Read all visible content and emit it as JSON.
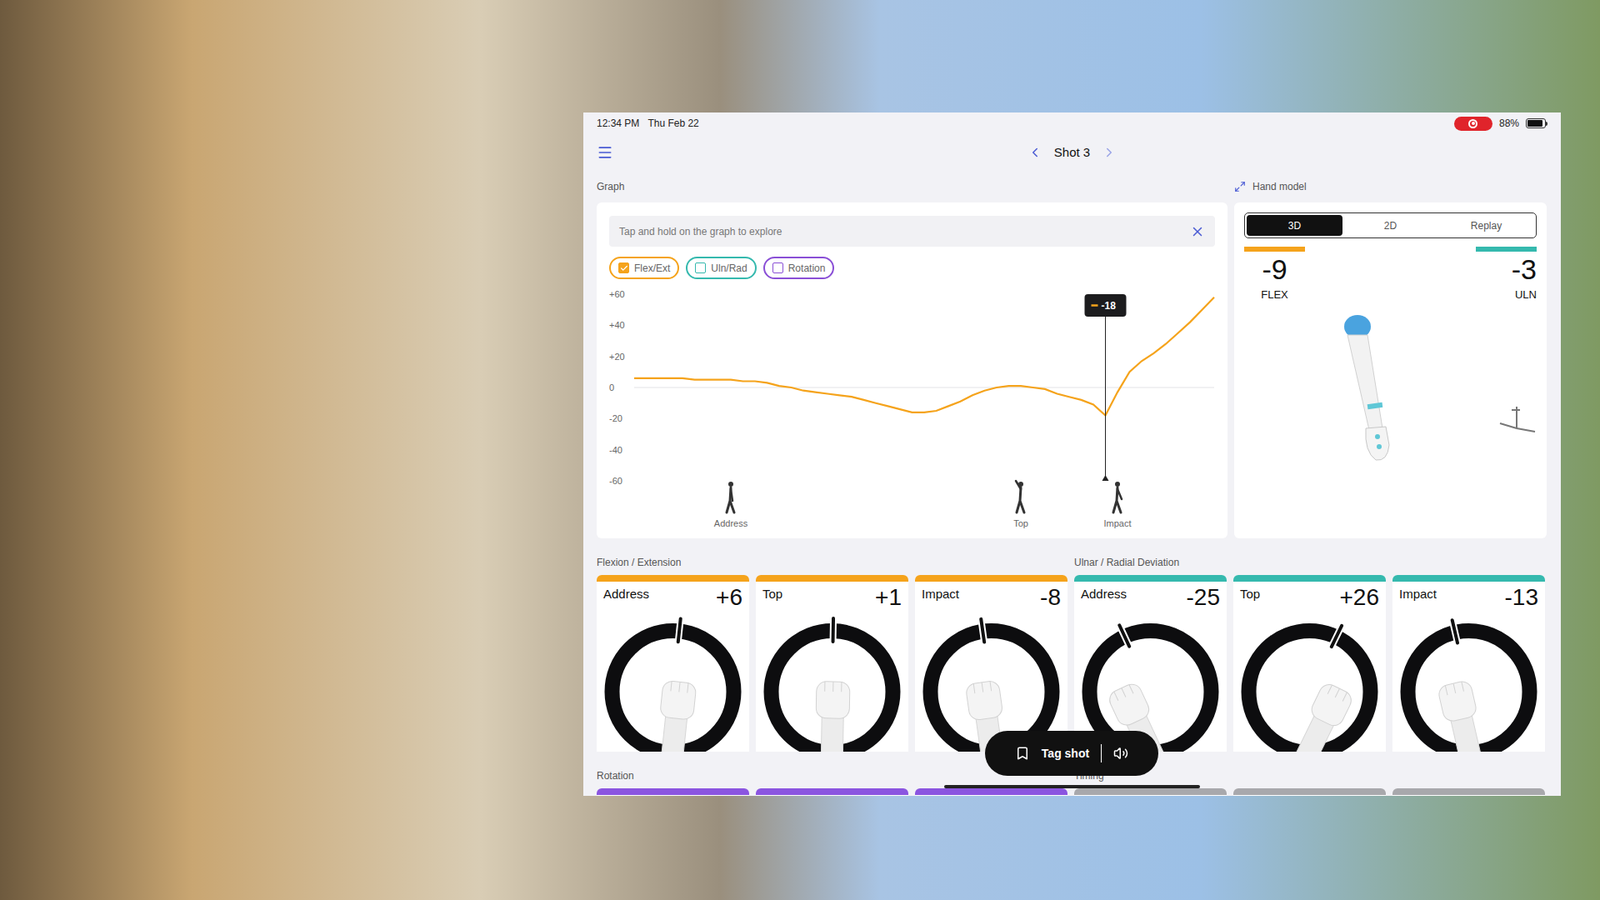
{
  "status_bar": {
    "time": "12:34 PM",
    "date": "Thu Feb 22",
    "battery": "88%",
    "battery_level": 0.88,
    "recording": true
  },
  "nav": {
    "title": "Shot 3"
  },
  "graph": {
    "title": "Graph",
    "hint": "Tap and hold on the graph to explore",
    "filters": [
      {
        "label": "Flex/Ext",
        "checked": true,
        "color": "#f5a31b"
      },
      {
        "label": "Uln/Rad",
        "checked": false,
        "color": "#35b9ae"
      },
      {
        "label": "Rotation",
        "checked": false,
        "color": "#8a4fd6"
      }
    ],
    "y_ticks": [
      {
        "label": "+60",
        "value": 60
      },
      {
        "label": "+40",
        "value": 40
      },
      {
        "label": "+20",
        "value": 20
      },
      {
        "label": "0",
        "value": 0
      },
      {
        "label": "-20",
        "value": -20
      },
      {
        "label": "-40",
        "value": -40
      },
      {
        "label": "-60",
        "value": -60
      }
    ],
    "series": [
      {
        "name": "Flex/Ext",
        "color": "#f5a31b",
        "values": [
          6,
          6,
          6,
          6,
          6,
          5,
          5,
          5,
          5,
          4,
          4,
          3,
          1,
          0,
          -2,
          -3,
          -4,
          -5,
          -6,
          -8,
          -10,
          -12,
          -14,
          -16,
          -16,
          -15,
          -12,
          -9,
          -5,
          -2,
          0,
          1,
          1,
          0,
          -1,
          -4,
          -6,
          -8,
          -11,
          -18,
          -3,
          10,
          17,
          22,
          28,
          35,
          42,
          50,
          58
        ]
      }
    ],
    "cursor": {
      "index": 39,
      "label": "-18"
    },
    "events": [
      {
        "label": "Address",
        "index": 8
      },
      {
        "label": "Top",
        "index": 32
      },
      {
        "label": "Impact",
        "index": 40
      }
    ]
  },
  "hand_model": {
    "title": "Hand model",
    "tabs": [
      {
        "label": "3D",
        "selected": true
      },
      {
        "label": "2D",
        "selected": false
      },
      {
        "label": "Replay",
        "selected": false
      }
    ],
    "readouts": [
      {
        "value": "-9",
        "label": "FLEX",
        "color": "#f5a31b"
      },
      {
        "value": "-3",
        "label": "ULN",
        "color": "#35b9ae"
      }
    ]
  },
  "metric_groups": [
    {
      "title": "Flexion / Extension",
      "color": "#f5a31b",
      "cards": [
        {
          "label": "Address",
          "value": "+6"
        },
        {
          "label": "Top",
          "value": "+1"
        },
        {
          "label": "Impact",
          "value": "-8"
        }
      ]
    },
    {
      "title": "Ulnar / Radial Deviation",
      "color": "#35b9ae",
      "cards": [
        {
          "label": "Address",
          "value": "-25"
        },
        {
          "label": "Top",
          "value": "+26"
        },
        {
          "label": "Impact",
          "value": "-13"
        }
      ]
    }
  ],
  "lower_groups": [
    {
      "title": "Rotation",
      "color": "#8b55e0",
      "card_count": 3
    },
    {
      "title": "Timing",
      "color": "#a8a8ac",
      "card_count": 3
    }
  ],
  "tag_button": {
    "label": "Tag shot"
  }
}
